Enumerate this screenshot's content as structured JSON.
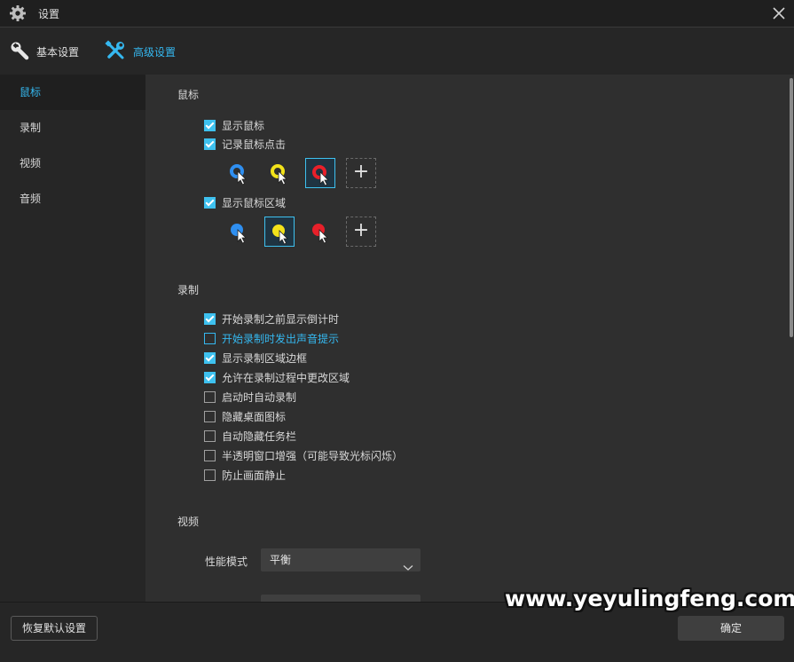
{
  "window": {
    "title": "设置",
    "icon": "gear-icon",
    "close_icon": "close-icon"
  },
  "tabs": [
    {
      "label": "基本设置",
      "icon": "wrench-icon",
      "active": false
    },
    {
      "label": "高级设置",
      "icon": "tools-icon",
      "active": true
    }
  ],
  "sidebar": {
    "items": [
      {
        "label": "鼠标",
        "active": true
      },
      {
        "label": "录制",
        "active": false
      },
      {
        "label": "视频",
        "active": false
      },
      {
        "label": "音频",
        "active": false
      }
    ]
  },
  "mouse": {
    "title": "鼠标",
    "show_cursor": {
      "label": "显示鼠标",
      "checked": true
    },
    "record_clicks": {
      "label": "记录鼠标点击",
      "checked": true
    },
    "click_styles": [
      {
        "icon": "blue-ring-cursor-icon",
        "color": "#2f8ff0",
        "selected": false
      },
      {
        "icon": "yellow-ring-cursor-icon",
        "color": "#f2e21a",
        "selected": false
      },
      {
        "icon": "red-ring-cursor-icon",
        "color": "#e8202a",
        "selected": true
      }
    ],
    "show_area": {
      "label": "显示鼠标区域",
      "checked": true
    },
    "area_styles": [
      {
        "icon": "blue-dot-cursor-icon",
        "color": "#2f8ff0",
        "selected": false
      },
      {
        "icon": "yellow-dot-cursor-icon",
        "color": "#f2e21a",
        "selected": true
      },
      {
        "icon": "red-dot-cursor-icon",
        "color": "#e8202a",
        "selected": false
      }
    ],
    "add_icon": "plus-icon",
    "add_label": "+"
  },
  "recording": {
    "title": "录制",
    "options": [
      {
        "label": "开始录制之前显示倒计时",
        "checked": true,
        "highlight": false
      },
      {
        "label": "开始录制时发出声音提示",
        "checked": false,
        "highlight": true
      },
      {
        "label": "显示录制区域边框",
        "checked": true,
        "highlight": false
      },
      {
        "label": "允许在录制过程中更改区域",
        "checked": true,
        "highlight": false
      },
      {
        "label": "启动时自动录制",
        "checked": false,
        "highlight": false
      },
      {
        "label": "隐藏桌面图标",
        "checked": false,
        "highlight": false
      },
      {
        "label": "自动隐藏任务栏",
        "checked": false,
        "highlight": false
      },
      {
        "label": "半透明窗口增强（可能导致光标闪烁）",
        "checked": false,
        "highlight": false
      },
      {
        "label": "防止画面静止",
        "checked": false,
        "highlight": false
      }
    ]
  },
  "video": {
    "title": "视频",
    "performance_label": "性能模式",
    "performance_value": "平衡"
  },
  "footer": {
    "reset_label": "恢复默认设置",
    "ok_label": "确定"
  },
  "watermark": "www.yeyulingfeng.com",
  "colors": {
    "accent": "#35b8f0",
    "checkbox": "#3ec1ef",
    "panel": "#2f2f2f",
    "sidebar": "#262626"
  }
}
